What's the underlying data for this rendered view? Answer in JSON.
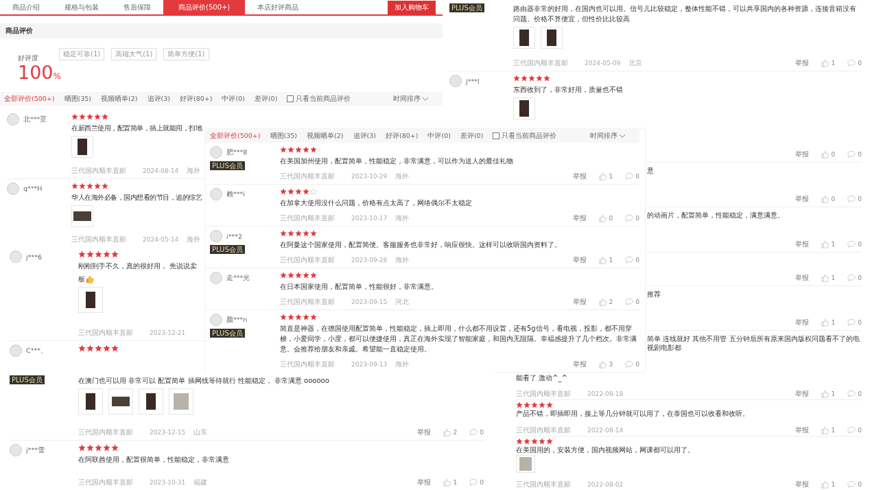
{
  "fragments": [
    {
      "kind": "header",
      "tabs": [
        {
          "label": "商品介绍",
          "selected": false
        },
        {
          "label": "规格与包装",
          "selected": false
        },
        {
          "label": "售后保障",
          "selected": false
        },
        {
          "label": "商品评价(500+)",
          "selected": true
        },
        {
          "label": "本店好评商品",
          "selected": false
        }
      ],
      "cart_button": "加入购物车",
      "section_title": "商品评价",
      "rating": {
        "label": "好评度",
        "value": "100",
        "unit": "%"
      },
      "tags": [
        "稳定可靠(1)",
        "高端大气(1)",
        "简单方便(1)"
      ],
      "filters": [
        {
          "label": "全部评价(500+)",
          "selected": true
        },
        {
          "label": "晒图(35)",
          "selected": false
        },
        {
          "label": "视频晒单(2)",
          "selected": false
        },
        {
          "label": "追评(3)",
          "selected": false
        },
        {
          "label": "好评(80+)",
          "selected": false
        },
        {
          "label": "中评(0)",
          "selected": false
        },
        {
          "label": "差评(0)",
          "selected": false
        }
      ],
      "only_current": {
        "label": "只看当前商品评价",
        "checked": false
      },
      "sort": "时间排序"
    },
    {
      "kind": "reviews",
      "reviews": [
        {
          "user": "北***至",
          "stars": 5,
          "text": "在新西兰使用，配置简单，插上就能用，扫地",
          "photos": [
            {
              "kind": "tall"
            }
          ],
          "source": "三代国内顺丰直邮",
          "date": "2024-08-14",
          "region": "海外"
        },
        {
          "user": "q***H",
          "stars": 5,
          "text": "华人在海外必备，国内想看的节目，追的综艺",
          "photos": [
            {
              "kind": "wide"
            }
          ],
          "source": "三代国内顺丰直邮",
          "date": "2024-05-14",
          "region": "海外"
        }
      ]
    },
    {
      "kind": "reviews",
      "reviews": [
        {
          "badge": "PLUS会员",
          "text": "路由器非常的好用，在国内也可以用。信号儿比较稳定，整体性能不错，可以共享国内的各种资源，连接音箱没有问题。价格不算便宜，但性价比比较高",
          "photos": [
            {
              "kind": "tall"
            },
            {
              "kind": "tall"
            }
          ],
          "source": "三代国内顺丰直邮",
          "date": "2024-05-09",
          "region": "北京",
          "report": "举报",
          "likes": "1",
          "replies": "0"
        },
        {
          "user": "j***l",
          "stars": 5,
          "text": "东西收到了，非常好用，质量也不错",
          "photos": [
            {
              "kind": "tall"
            }
          ]
        }
      ]
    },
    {
      "kind": "reviews",
      "reviews": [
        {
          "user": "j***6",
          "stars": 5,
          "text_lines": [
            "刚刚到手不久，真的很好用， 先说说卖",
            "板"
          ],
          "thumbs_up": true,
          "photos": [
            {
              "kind": "tall"
            }
          ],
          "source": "三代国内顺丰直邮",
          "date": "2023-12-21"
        },
        {
          "user": "C***、",
          "stars": 5
        }
      ]
    },
    {
      "kind": "feed",
      "filters": [
        {
          "label": "全部评价(500+)",
          "selected": true
        },
        {
          "label": "晒图(35)",
          "selected": false
        },
        {
          "label": "视频晒单(2)",
          "selected": false
        },
        {
          "label": "追评(3)",
          "selected": false
        },
        {
          "label": "好评(80+)",
          "selected": false
        },
        {
          "label": "中评(0)",
          "selected": false
        },
        {
          "label": "差评(0)",
          "selected": false
        }
      ],
      "only_current": {
        "label": "只看当前商品评价",
        "checked": false
      },
      "sort": "时间排序",
      "reviews": [
        {
          "user": "肥***8",
          "badge": "PLUS会员",
          "stars": 5,
          "text": "在美国加州使用，配置简单，性能稳定，非常满意，可以作为送人的最佳礼物",
          "source": "三代国内顺丰直邮",
          "date": "2023-10-29",
          "region": "海外",
          "report": "举报",
          "likes": "1",
          "replies": "0"
        },
        {
          "user": "赖***i",
          "stars": 4,
          "text": "在加拿大使用没什么问题，价格有点太高了，网络偶尔不太稳定",
          "source": "三代国内顺丰直邮",
          "date": "2023-10-17",
          "region": "海外",
          "report": "举报",
          "likes": "0",
          "replies": "0"
        },
        {
          "user": "i***2",
          "badge": "PLUS会员",
          "stars": 5,
          "text": "在阿曼这个国家使用，配置简便。客服服务也非常好，响应很快。这样可以收听国内资料了。",
          "source": "三代国内顺丰直邮",
          "date": "2023-09-28",
          "region": "海外",
          "report": "举报",
          "likes": "1",
          "replies": "0"
        },
        {
          "user": "走***光",
          "stars": 5,
          "text": "在日本国家使用，配置简单，性能很好，非常满意。",
          "source": "三代国内顺丰直邮",
          "date": "2023-09-15",
          "region": "河北",
          "report": "举报",
          "likes": "2",
          "replies": "0"
        },
        {
          "user": "颜***n",
          "badge": "PLUS会员",
          "stars": 5,
          "text": "简直是神器，在德国使用配置简单，性能稳定，插上即用，什么都不用设置，还有5g信号，看电视，投影，都不用穿梭，小爱同学，小度，都可以便捷使用，真正在海外实现了智能家庭，和国内无阻隔。幸福感提升了几个档次。非常满意。会推荐给朋友和亲戚。希望能一直稳定使用。",
          "source": "三代国内顺丰直邮",
          "date": "2023-09-13",
          "region": "海外",
          "report": "举报",
          "likes": "3",
          "replies": "0"
        }
      ]
    },
    {
      "kind": "reviews",
      "reviews": [
        {
          "report": "举报",
          "likes": "0",
          "replies": "0"
        },
        {
          "text": "意",
          "report": "举报",
          "likes": "0",
          "replies": "0"
        },
        {
          "text": "的动画片，配置简单，性能稳定，满意满意。",
          "report": "举报",
          "likes": "1",
          "replies": "0"
        },
        {
          "report": "举报",
          "likes": "1",
          "replies": "0"
        },
        {
          "text": "推荐",
          "report": "举报",
          "likes": "1",
          "replies": "0"
        },
        {
          "text": "简单 连线就好 其他不用管 五分钟后所有原来国内版权问题看不了的电视剧电影都"
        }
      ]
    },
    {
      "kind": "reviews",
      "reviews": [
        {
          "badge": "PLUS会员",
          "text": "在澳门也可以用 非常可以 配置简单 插网线等待就行 性能稳定， 非常满意 oooooo",
          "photos": [
            {
              "kind": "tall"
            },
            {
              "kind": "wide"
            },
            {
              "kind": "tall"
            },
            {
              "kind": "square"
            }
          ],
          "source": "三代国内顺丰直邮",
          "date": "2023-12-15",
          "region": "山东",
          "report": "举报",
          "likes": "2",
          "replies": "0"
        },
        {
          "user": "j***雪",
          "stars": 5,
          "text": "在阿联酋使用，配置很简单，性能稳定，非常满意",
          "source": "三代国内顺丰直邮",
          "date": "2023-10-31",
          "region": "福建",
          "report": "举报",
          "likes": "1",
          "replies": "0"
        }
      ]
    },
    {
      "kind": "reviews",
      "reviews": [
        {
          "text": "能看了 激动^_^",
          "source": "三代国内顺丰直邮",
          "date": "2022-08-18",
          "report": "举报",
          "likes": "1",
          "replies": "0"
        },
        {
          "stars": 5,
          "text": "产品不错，即插即用，接上等几分钟就可以用了，在泰国也可以收看和收听。",
          "source": "三代国内顺丰直邮",
          "date": "2022-08-14",
          "report": "举报",
          "likes": "1",
          "replies": "0"
        },
        {
          "stars": 5,
          "text": "在美国用的，安装方便，国内视频网站，网课都可以用了。",
          "photos": [
            {
              "kind": "square"
            }
          ],
          "source": "三代国内顺丰直邮",
          "date": "2022-08-02",
          "report": "举报",
          "likes": "1",
          "replies": "0"
        }
      ]
    }
  ]
}
